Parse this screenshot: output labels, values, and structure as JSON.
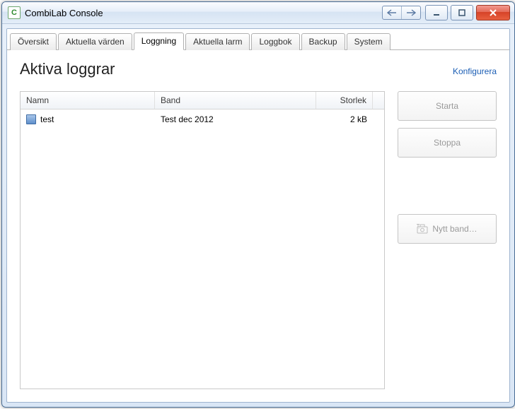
{
  "window": {
    "title": "CombiLab Console"
  },
  "tabs": [
    {
      "label": "Översikt",
      "active": false
    },
    {
      "label": "Aktuella värden",
      "active": false
    },
    {
      "label": "Loggning",
      "active": true
    },
    {
      "label": "Aktuella larm",
      "active": false
    },
    {
      "label": "Loggbok",
      "active": false
    },
    {
      "label": "Backup",
      "active": false
    },
    {
      "label": "System",
      "active": false
    }
  ],
  "page": {
    "heading": "Aktiva loggrar",
    "configure_label": "Konfigurera"
  },
  "table": {
    "columns": {
      "name": "Namn",
      "band": "Band",
      "size": "Storlek"
    },
    "rows": [
      {
        "name": "test",
        "band": "Test dec 2012",
        "size": "2 kB"
      }
    ]
  },
  "buttons": {
    "start": "Starta",
    "stop": "Stoppa",
    "new_band": "Nytt band…"
  }
}
